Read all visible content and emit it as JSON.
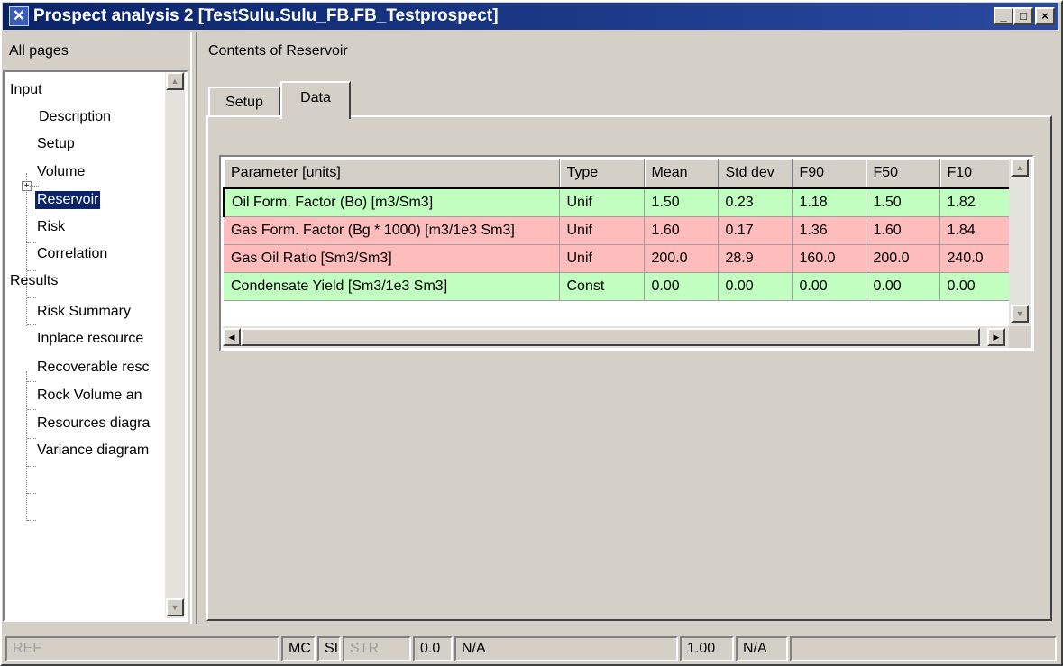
{
  "window": {
    "title": "Prospect analysis 2 [TestSulu.Sulu_FB.FB_Testprospect]",
    "icon": "app-x-icon",
    "controls": {
      "minimize": "_",
      "maximize": "□",
      "close": "×"
    }
  },
  "left_pane": {
    "header": "All pages",
    "tree": {
      "input_label": "Input",
      "input_items": [
        "Description",
        "Setup",
        "Volume",
        "Reservoir",
        "Risk",
        "Correlation"
      ],
      "selected": "Reservoir",
      "results_label": "Results",
      "results_items": [
        "Risk Summary",
        "Inplace resource",
        "Recoverable resc",
        "Rock Volume an",
        "Resources diagra",
        "Variance diagram"
      ]
    }
  },
  "right_pane": {
    "header": "Contents of Reservoir",
    "tabs": [
      {
        "label": "Setup",
        "active": false
      },
      {
        "label": "Data",
        "active": true
      }
    ],
    "grid": {
      "columns": [
        "Parameter [units]",
        "Type",
        "Mean",
        "Std dev",
        "F90",
        "F50",
        "F10"
      ],
      "rows": [
        {
          "cells": [
            "Oil Form. Factor (Bo) [m3/Sm3]",
            "Unif",
            "1.50",
            "0.23",
            "1.18",
            "1.50",
            "1.82"
          ],
          "color": "#c0ffc0",
          "selected": true
        },
        {
          "cells": [
            "Gas Form. Factor (Bg * 1000) [m3/1e3 Sm3]",
            "Unif",
            "1.60",
            "0.17",
            "1.36",
            "1.60",
            "1.84"
          ],
          "color": "#ffbcbc",
          "selected": false
        },
        {
          "cells": [
            "Gas Oil Ratio [Sm3/Sm3]",
            "Unif",
            "200.0",
            "28.9",
            "160.0",
            "200.0",
            "240.0"
          ],
          "color": "#ffbcbc",
          "selected": false
        },
        {
          "cells": [
            "Condensate Yield [Sm3/1e3 Sm3]",
            "Const",
            "0.00",
            "0.00",
            "0.00",
            "0.00",
            "0.00"
          ],
          "color": "#c0ffc0",
          "selected": false
        }
      ]
    }
  },
  "status_bar": {
    "ref": "REF",
    "mc": "MC",
    "si": "SI",
    "str": "STR",
    "value1": "0.0",
    "na1": "N/A",
    "value2": "1.00",
    "na2": "N/A",
    "last": ""
  },
  "colors": {
    "title_bar": "#0a246a",
    "selection": "#0a246a",
    "row_green": "#c0ffc0",
    "row_red": "#ffbcbc",
    "face": "#d4d0c8"
  }
}
